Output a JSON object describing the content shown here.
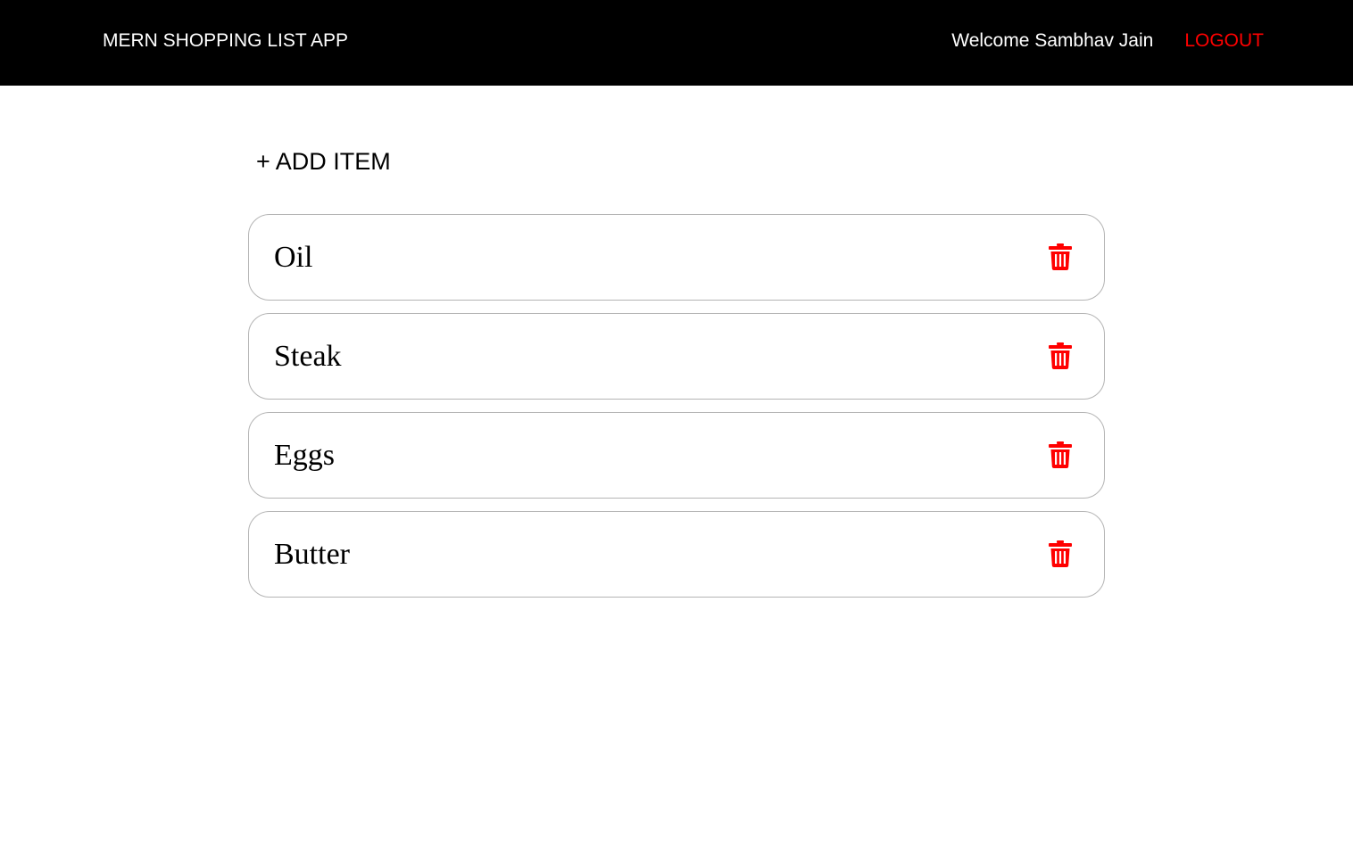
{
  "navbar": {
    "brand": "MERN SHOPPING LIST APP",
    "welcome_text": "Welcome Sambhav Jain",
    "logout_label": "LOGOUT"
  },
  "main": {
    "add_item_label": "+ ADD ITEM",
    "items": [
      {
        "name": "Oil",
        "delete_icon": "trash-icon"
      },
      {
        "name": "Steak",
        "delete_icon": "trash-icon"
      },
      {
        "name": "Eggs",
        "delete_icon": "trash-icon"
      },
      {
        "name": "Butter",
        "delete_icon": "trash-icon"
      }
    ]
  },
  "colors": {
    "navbar_background": "#000000",
    "navbar_text": "#ffffff",
    "logout": "#ff0000",
    "delete_icon": "#ff0000",
    "card_border": "#b4b4b4"
  }
}
